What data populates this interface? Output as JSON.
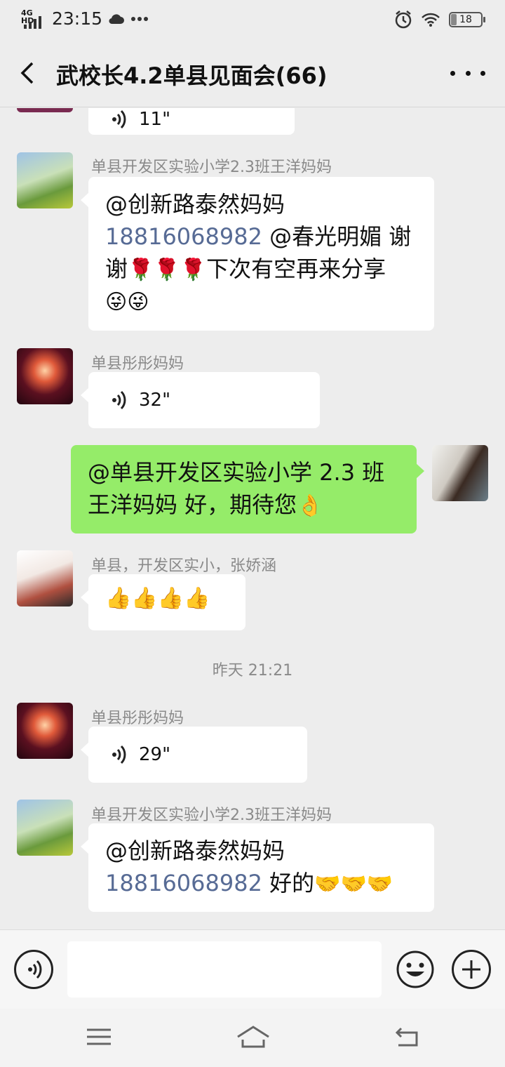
{
  "status_bar": {
    "network": "4G HD",
    "time": "23:15",
    "battery": "18"
  },
  "header": {
    "title": "武校长4.2单县见面会(66)"
  },
  "messages": [
    {
      "voice_partial": "11\""
    },
    {
      "sender": "单县开发区实验小学2.3班王洋妈妈",
      "line1": "@创新路泰然妈妈",
      "line2_mention": "18816068982",
      "line2_rest": " @春光明媚  谢",
      "line3_a": "谢",
      "line3_b": "下次有空再来分享",
      "emojis_a": "🌹🌹🌹",
      "emojis_b": "😜😜"
    },
    {
      "sender": "单县彤彤妈妈",
      "duration": "32\""
    },
    {
      "line1": "@单县开发区实验小学 2.3 班",
      "line2": "王洋妈妈  好，期待您",
      "emoji": "👌"
    },
    {
      "sender": "单县，开发区实小，张娇涵",
      "emojis": "👍👍👍👍"
    },
    {
      "timestamp": "昨天 21:21"
    },
    {
      "sender": "单县彤彤妈妈",
      "duration": "29\""
    },
    {
      "sender": "单县开发区实验小学2.3班王洋妈妈",
      "line1": "@创新路泰然妈妈",
      "line2_mention": "18816068982",
      "line2_rest": "  好的",
      "emojis": "🤝🤝🤝"
    }
  ],
  "colors": {
    "self_bubble": "#95ec69",
    "other_bubble": "#ffffff",
    "mention": "#576b95",
    "background": "#ededed"
  },
  "icons": [
    "back-icon",
    "more-icon",
    "voice-icon",
    "emoji-icon",
    "plus-icon",
    "menu-icon",
    "home-icon",
    "return-icon",
    "alarm-icon",
    "wifi-icon",
    "cloud-icon"
  ]
}
